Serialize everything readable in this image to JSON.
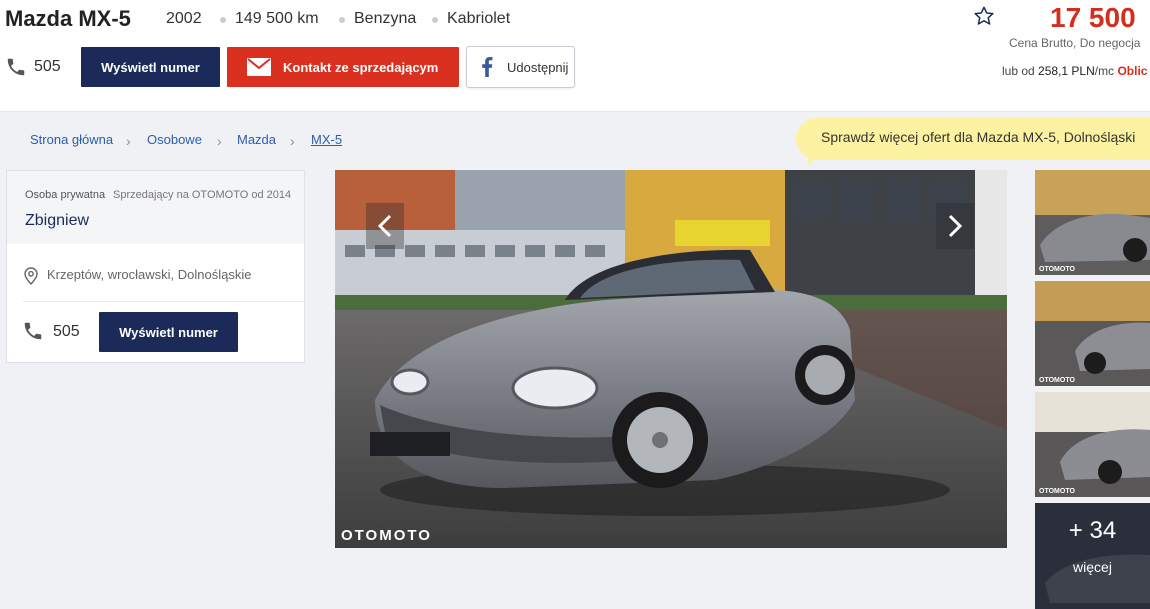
{
  "header": {
    "title": "Mazda MX-5",
    "year": "2002",
    "mileage": "149 500 km",
    "fuel": "Benzyna",
    "body": "Kabriolet",
    "phone_prefix": "505",
    "show_number": "Wyświetl numer",
    "contact": "Kontakt ze sprzedającym",
    "share": "Udostępnij",
    "price": "17 500",
    "price_note": "Cena Brutto, Do negocja",
    "installment_prefix": "lub od",
    "installment_amount": "258,1 PLN",
    "installment_unit": "/mc",
    "installment_link": "Oblic"
  },
  "breadcrumb": [
    "Strona główna",
    "Osobowe",
    "Mazda",
    "MX-5"
  ],
  "tooltip": "Sprawdź więcej ofert dla Mazda MX-5, Dolnośląski",
  "seller": {
    "type": "Osoba prywatna",
    "since": "Sprzedający na OTOMOTO od 2014",
    "name": "Zbigniew",
    "location": "Krzeptów, wrocławski, Dolnośląskie",
    "phone_prefix": "505",
    "show_number": "Wyświetl numer"
  },
  "gallery": {
    "watermark": "OTOMOTO",
    "thumb_watermark": "OTOMOTO",
    "more_count": "+ 34",
    "more_label": "więcej"
  },
  "colors": {
    "navy": "#1b2a59",
    "red": "#d9301f",
    "price": "#d22f1f",
    "link": "#2a5eaa",
    "tooltip": "#fdf2a2"
  }
}
